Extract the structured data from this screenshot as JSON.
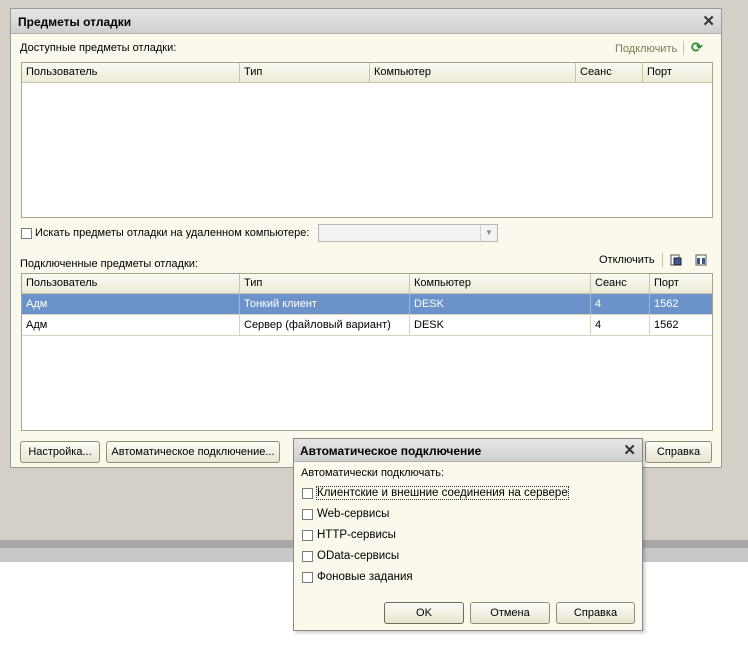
{
  "main": {
    "title": "Предметы отладки",
    "available_label": "Доступные предметы отладки:",
    "connect_link": "Подключить",
    "refresh_icon": "refresh-icon",
    "available_columns": [
      "Пользователь",
      "Тип",
      "Компьютер",
      "Сеанс",
      "Порт"
    ],
    "search_remote_label": "Искать предметы отладки на удаленном компьютере:",
    "connected_label": "Подключенные предметы отладки:",
    "disconnect_link": "Отключить",
    "connected_columns": [
      "Пользователь",
      "Тип",
      "Компьютер",
      "Сеанс",
      "Порт"
    ],
    "connected_rows": [
      [
        "Адм",
        "Тонкий клиент",
        "DESK",
        "4",
        "1562"
      ],
      [
        "Адм",
        "Сервер (файловый вариант)",
        "DESK",
        "4",
        "1562"
      ]
    ],
    "settings_button": "Настройка...",
    "auto_connect_button": "Автоматическое подключение...",
    "help_button": "Справка"
  },
  "dialog": {
    "title": "Автоматическое подключение",
    "subtitle": "Автоматически подключать:",
    "options": [
      "Клиентские и внешние соединения на сервере",
      "Web-сервисы",
      "HTTP-сервисы",
      "OData-сервисы",
      "Фоновые задания"
    ],
    "ok_button": "OK",
    "cancel_button": "Отмена",
    "help_button": "Справка"
  },
  "colors": {
    "selection": "#6c93c9",
    "window_bg": "#fbf9ec",
    "desktop": "#d4d0c8"
  }
}
